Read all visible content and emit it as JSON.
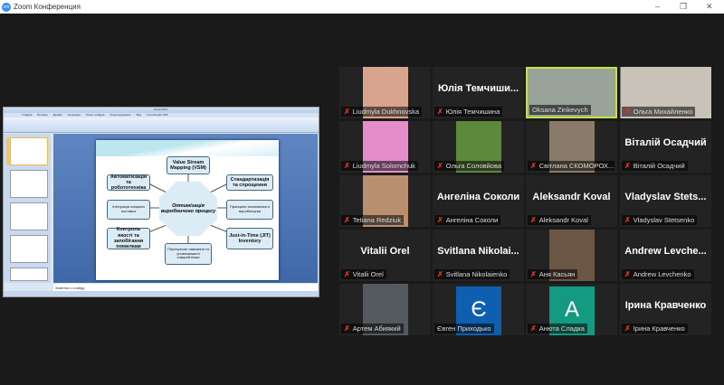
{
  "window": {
    "title": "Zoom Конференция",
    "logo": "zm"
  },
  "controls": {
    "minimize": "–",
    "restore": "❐",
    "close": "✕"
  },
  "share": {
    "ppt_title": "PowerPoint",
    "ribbon_tabs": [
      "Главная",
      "Вставка",
      "Дизайн",
      "Анимация",
      "Показ слайдов",
      "Рецензирование",
      "Вид",
      "Foxit Reader PDF"
    ],
    "notes_placeholder": "Заметки к слайду",
    "slide": {
      "center": "Оптимізація виробничого процесу",
      "boxes": [
        "Value Stream Mapping (VSM)",
        "Автоматизація та робототехніка",
        "Стандартизація та спрощення",
        "Інтеграція ланцюга поставок",
        "Принципи економічного виробництва",
        "Контроль якості та запобігання помилкам",
        "Just-in-Time (JIT) Inventory",
        "Перехресне навчання та уповноважені співробітники"
      ]
    }
  },
  "participants": [
    {
      "name": "Liudmyla Dukhnovska",
      "type": "photo",
      "color": "#d9a48e",
      "muted": true
    },
    {
      "name": "Юлія Темчишина",
      "big": "Юлія Темчиши...",
      "type": "name",
      "muted": true
    },
    {
      "name": "Oksana Zinkevych",
      "type": "photo",
      "color": "#9aa39a",
      "muted": false,
      "active": true,
      "wide": true
    },
    {
      "name": "Ольга Михайленко",
      "type": "photo",
      "color": "#c9c2b8",
      "muted": true,
      "wide": true
    },
    {
      "name": "Liudmyla Solomchuk",
      "type": "photo",
      "color": "#e38dc9",
      "muted": true
    },
    {
      "name": "Ольга Соловйова",
      "type": "photo",
      "color": "#5d8a3a",
      "muted": true
    },
    {
      "name": "Світлана СКОМОРОХ...",
      "type": "photo",
      "color": "#8a7a6a",
      "muted": true
    },
    {
      "name": "Віталій Осадчий",
      "big": "Віталій Осадчий",
      "type": "name",
      "muted": true
    },
    {
      "name": "Tetiana Redziuk",
      "type": "photo",
      "color": "#b89070",
      "muted": true
    },
    {
      "name": "Ангеліна Соколи",
      "big": "Ангеліна Соколи",
      "type": "name",
      "muted": true
    },
    {
      "name": "Aleksandr Koval",
      "big": "Aleksandr Koval",
      "type": "name",
      "muted": true
    },
    {
      "name": "Vladyslav Stetsenko",
      "big": "Vladyslav  Stets...",
      "type": "name",
      "muted": true
    },
    {
      "name": "Vitalii Orel",
      "big": "Vitalii Orel",
      "type": "name",
      "muted": true
    },
    {
      "name": "Svitlana Nikolaienko",
      "big": "Svitlana  Nikolai...",
      "type": "name",
      "muted": true
    },
    {
      "name": "Аня Касьян",
      "type": "photo",
      "color": "#6b5545",
      "muted": true
    },
    {
      "name": "Andrew Levchenko",
      "big": "Andrew  Levche...",
      "type": "name",
      "muted": true
    },
    {
      "name": "Артем Абиякий",
      "type": "photo",
      "color": "#555a60",
      "muted": true
    },
    {
      "name": "Євген Приходько",
      "type": "avatar",
      "letter": "Є",
      "color": "#0e5fb0",
      "muted": false
    },
    {
      "name": "Анюта Сладка",
      "type": "avatar",
      "letter": "A",
      "color": "#159a82",
      "muted": true
    },
    {
      "name": "Ірина Кравченко",
      "big": "Ірина Кравченко",
      "type": "name",
      "muted": true
    }
  ],
  "mic_muted_icon": "🎙"
}
